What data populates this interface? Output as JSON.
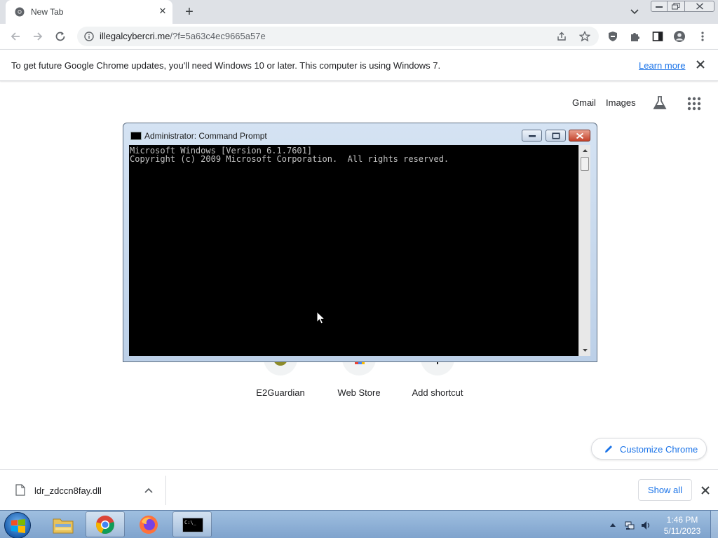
{
  "browser": {
    "tab": {
      "title": "New Tab"
    },
    "omnibox": {
      "host": "illegalcybercri.me",
      "path": "/?f=5a63c4ec9665a57e"
    }
  },
  "infobar": {
    "message": "To get future Google Chrome updates, you'll need Windows 10 or later. This computer is using Windows 7.",
    "link": "Learn more"
  },
  "ntp": {
    "links": [
      "Gmail",
      "Images"
    ],
    "shortcuts": [
      {
        "label": "E2Guardian"
      },
      {
        "label": "Web Store"
      },
      {
        "label": "Add shortcut"
      }
    ],
    "customize_label": "Customize Chrome"
  },
  "cmd": {
    "title": "Administrator:  Command Prompt",
    "lines": [
      "Microsoft Windows [Version 6.1.7601]",
      "Copyright (c) 2009 Microsoft Corporation.  All rights reserved."
    ]
  },
  "downloads": {
    "file_name": "ldr_zdccn8fay.dll",
    "show_all": "Show all"
  },
  "taskbar": {
    "time": "1:46 PM",
    "date": "5/11/2023",
    "cmd_icon_text": "C:\\_"
  }
}
